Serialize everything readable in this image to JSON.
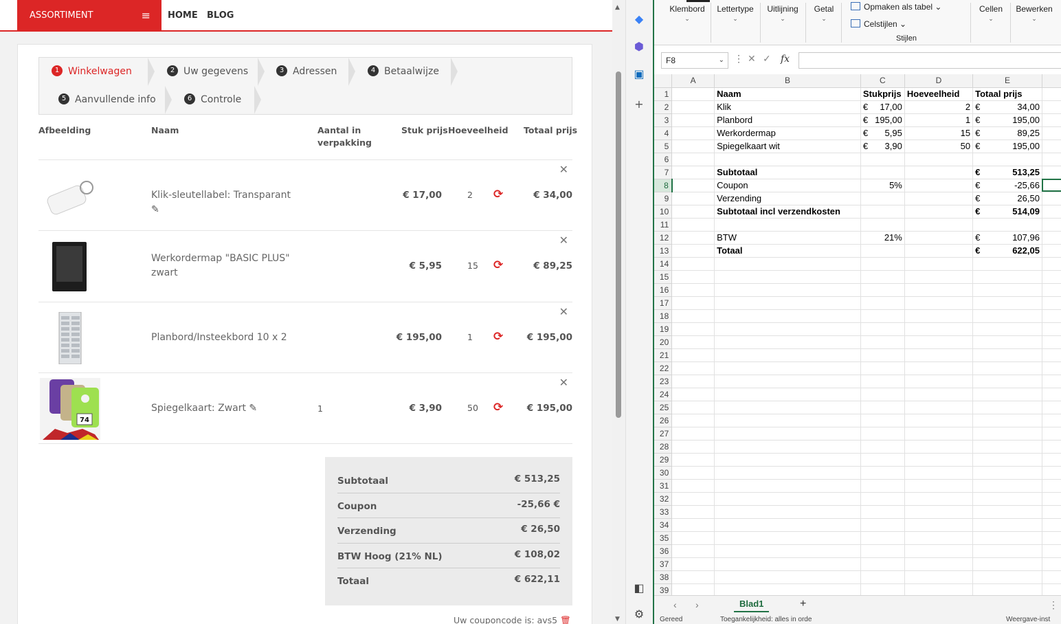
{
  "shop": {
    "nav": {
      "assortiment": "ASSORTIMENT",
      "menu_icon": "hamburger-icon",
      "home": "HOME",
      "blog": "BLOG"
    },
    "steps": [
      {
        "num": "1",
        "label": "Winkelwagen",
        "active": true
      },
      {
        "num": "2",
        "label": "Uw gegevens"
      },
      {
        "num": "3",
        "label": "Adressen"
      },
      {
        "num": "4",
        "label": "Betaalwijze"
      },
      {
        "num": "5",
        "label": "Aanvullende info"
      },
      {
        "num": "6",
        "label": "Controle"
      }
    ],
    "headers": {
      "image": "Afbeelding",
      "name": "Naam",
      "pack_1": "Aantal in",
      "pack_2": "verpakking",
      "unit_price": "Stuk prijs",
      "quantity": "Hoeveelheid",
      "total": "Totaal prijs"
    },
    "items": [
      {
        "name": "Klik-sleutellabel: Transparant",
        "pack": "",
        "unit_price": "€ 17,00",
        "qty": "2",
        "total": "€ 34,00"
      },
      {
        "name": "Werkordermap \"BASIC PLUS\" zwart",
        "pack": "",
        "unit_price": "€ 5,95",
        "qty": "15",
        "total": "€ 89,25"
      },
      {
        "name": "Planbord/Insteekbord 10 x 2",
        "pack": "",
        "unit_price": "€ 195,00",
        "qty": "1",
        "total": "€ 195,00"
      },
      {
        "name": "Spiegelkaart: Zwart",
        "pack": "1",
        "unit_price": "€ 3,90",
        "qty": "50",
        "total": "€ 195,00"
      }
    ],
    "summary": [
      {
        "label": "Subtotaal",
        "value": "€ 513,25"
      },
      {
        "label": "Coupon",
        "value": "-25,66 €"
      },
      {
        "label": "Verzending",
        "value": "€ 26,50"
      },
      {
        "label": "BTW Hoog (21% NL)",
        "value": "€ 108,02"
      },
      {
        "label": "Totaal",
        "value": "€ 622,11"
      }
    ],
    "coupon_text": "Uw couponcode is: avs5",
    "accent": "#dc2626"
  },
  "excel": {
    "ribbon": {
      "klembord": "Klembord",
      "lettertype": "Lettertype",
      "uitlijning": "Uitlijning",
      "getal": "Getal",
      "opmaken": "Opmaken als tabel",
      "celstijlen": "Celstijlen",
      "stijlen": "Stijlen",
      "cellen": "Cellen",
      "bewerken": "Bewerken"
    },
    "namebox": "F8",
    "columns": [
      "A",
      "B",
      "C",
      "D",
      "E"
    ],
    "rows": [
      {
        "n": "1",
        "b": "Naam",
        "c": "Stukprijs",
        "d": "Hoeveelheid",
        "e": "Totaal prijs",
        "bold": true,
        "header": true
      },
      {
        "n": "2",
        "b": "Klik",
        "c_cur": "€",
        "c": "17,00",
        "d": "2",
        "e_cur": "€",
        "e": "34,00"
      },
      {
        "n": "3",
        "b": "Planbord",
        "c_cur": "€",
        "c": "195,00",
        "d": "1",
        "e_cur": "€",
        "e": "195,00"
      },
      {
        "n": "4",
        "b": "Werkordermap",
        "c_cur": "€",
        "c": "5,95",
        "d": "15",
        "e_cur": "€",
        "e": "89,25"
      },
      {
        "n": "5",
        "b": "Spiegelkaart wit",
        "c_cur": "€",
        "c": "3,90",
        "d": "50",
        "e_cur": "€",
        "e": "195,00"
      },
      {
        "n": "6"
      },
      {
        "n": "7",
        "b": "Subtotaal",
        "e_cur": "€",
        "e": "513,25",
        "bold": true
      },
      {
        "n": "8",
        "b": "Coupon",
        "c": "5%",
        "e_cur": "€",
        "e": "-25,66"
      },
      {
        "n": "9",
        "b": "Verzending",
        "e_cur": "€",
        "e": "26,50"
      },
      {
        "n": "10",
        "b": "Subtotaal incl verzendkosten",
        "e_cur": "€",
        "e": "514,09",
        "bold": true
      },
      {
        "n": "11"
      },
      {
        "n": "12",
        "b": "BTW",
        "c": "21%",
        "e_cur": "€",
        "e": "107,96"
      },
      {
        "n": "13",
        "b": "Totaal",
        "e_cur": "€",
        "e": "622,05",
        "bold": true
      }
    ],
    "empty_rows": [
      "14",
      "15",
      "16",
      "17",
      "18",
      "19",
      "20",
      "21",
      "22",
      "23",
      "24",
      "25",
      "26",
      "27",
      "28",
      "29",
      "30",
      "31",
      "32",
      "33",
      "34",
      "35",
      "36",
      "37",
      "38",
      "39"
    ],
    "sheet_tab": "Blad1",
    "status_left": "Gereed",
    "status_access": "Toegankelijkheid: alles in orde",
    "status_right": "Weergave-inst",
    "accent": "#217346"
  }
}
